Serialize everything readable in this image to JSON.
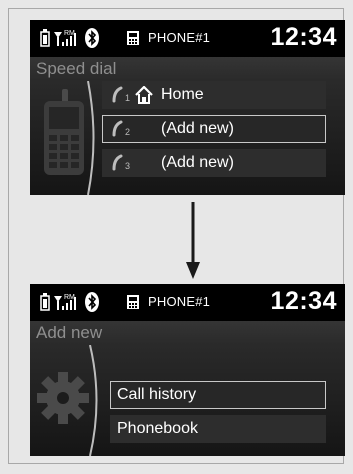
{
  "screen1": {
    "status": {
      "rm": "RM",
      "phone_label": "PHONE#1",
      "clock": "12:34"
    },
    "header": "Speed dial",
    "items": [
      {
        "num": "1",
        "label": "Home",
        "icon": "home-icon",
        "selected": false
      },
      {
        "num": "2",
        "label": "(Add new)",
        "selected": true
      },
      {
        "num": "3",
        "label": "(Add new)",
        "selected": false
      }
    ]
  },
  "screen2": {
    "status": {
      "rm": "RM",
      "phone_label": "PHONE#1",
      "clock": "12:34"
    },
    "header": "Add new",
    "items": [
      {
        "label": "Call history",
        "selected": true
      },
      {
        "label": "Phonebook",
        "selected": false
      }
    ]
  },
  "colors": {
    "screen_bg": "#000000",
    "header_text": "#8f8f8f",
    "selected_border": "#c8c8c8",
    "page_bg": "#e7e7e7"
  }
}
